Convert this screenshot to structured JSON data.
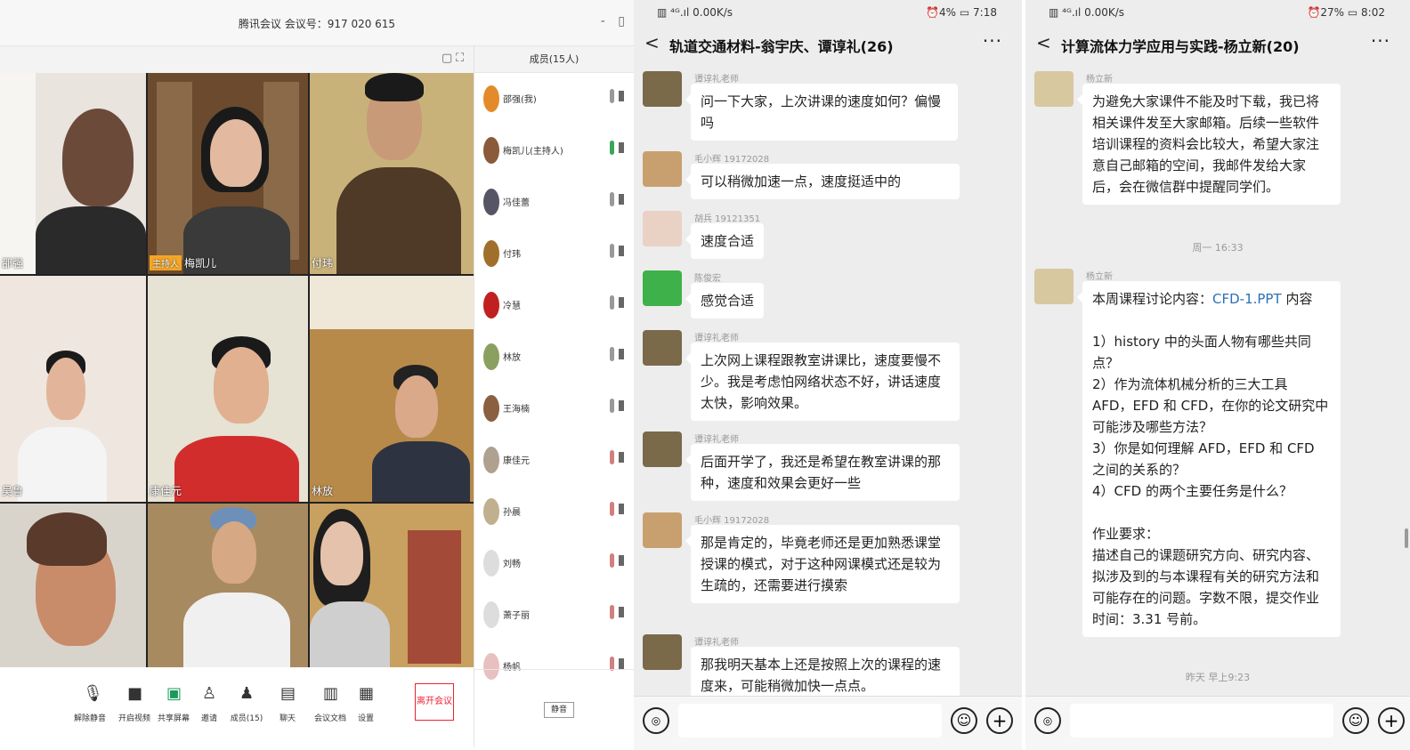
{
  "meeting": {
    "title": "腾讯会议 会议号：917 020 615",
    "window_controls": [
      "-",
      "▯"
    ],
    "members_header": "成员(15人)",
    "tiles": [
      {
        "name": "邵强",
        "host": ""
      },
      {
        "name": "梅凯儿",
        "host": "主持人"
      },
      {
        "name": "付玮",
        "host": ""
      },
      {
        "name": "吴鲁",
        "host": ""
      },
      {
        "name": "康佳元",
        "host": ""
      },
      {
        "name": "林放",
        "host": ""
      },
      {
        "name": "",
        "host": ""
      },
      {
        "name": "",
        "host": ""
      },
      {
        "name": "",
        "host": ""
      }
    ],
    "members": [
      {
        "name": "邵强(我)"
      },
      {
        "name": "梅凯儿(主持人)"
      },
      {
        "name": "冯佳蕾"
      },
      {
        "name": "付玮"
      },
      {
        "name": "冷慧"
      },
      {
        "name": "林放"
      },
      {
        "name": "王海楠"
      },
      {
        "name": "康佳元"
      },
      {
        "name": "孙晨"
      },
      {
        "name": "刘畅"
      },
      {
        "name": "萧子丽"
      },
      {
        "name": "杨帆"
      }
    ],
    "members_footer_button": "静音",
    "toolbar": [
      {
        "label": "解除静音",
        "icon": "mic-icon",
        "glyph": "🎤"
      },
      {
        "label": "开启视频",
        "icon": "camera-icon",
        "glyph": "■"
      },
      {
        "label": "共享屏幕",
        "icon": "share-screen-icon",
        "glyph": "▣"
      },
      {
        "label": "邀请",
        "icon": "invite-icon",
        "glyph": "♙"
      },
      {
        "label": "成员(15)",
        "icon": "members-icon",
        "glyph": "♟"
      },
      {
        "label": "聊天",
        "icon": "chat-icon",
        "glyph": "▤"
      },
      {
        "label": "会议文档",
        "icon": "document-icon",
        "glyph": "▥"
      },
      {
        "label": "设置",
        "icon": "settings-icon",
        "glyph": "▦"
      }
    ],
    "end_button": "离开会议"
  },
  "chat1": {
    "status_left": "▥ ⁴ᴳ.ıl 0.00K/s",
    "status_right": "⏰4% ▭ 7:18",
    "title": "轨道交通材料-翁宇庆、谭谆礼(26)",
    "more": "···",
    "back": "<",
    "messages": [
      {
        "sender": "谭谆礼老师",
        "text": "问一下大家，上次讲课的速度如何？偏慢吗"
      },
      {
        "sender": "毛小辉 19172028",
        "text": "可以稍微加速一点，速度挺适中的"
      },
      {
        "sender": "胡兵 19121351",
        "text": "速度合适"
      },
      {
        "sender": "陈俊宏",
        "text": "感觉合适"
      },
      {
        "sender": "谭谆礼老师",
        "text": "上次网上课程跟教室讲课比，速度要慢不少。我是考虑怕网络状态不好，讲话速度太快，影响效果。"
      },
      {
        "sender": "谭谆礼老师",
        "text": "后面开学了，我还是希望在教室讲课的那种，速度和效果会更好一些"
      },
      {
        "sender": "毛小辉 19172028",
        "text": "那是肯定的，毕竟老师还是更加熟悉课堂授课的模式，对于这种网课模式还是较为生疏的，还需要进行摸索"
      },
      {
        "sender": "谭谆礼老师",
        "text": "那我明天基本上还是按照上次的课程的速度来，可能稍微加快一点点。"
      }
    ],
    "voice": "◎",
    "emoji": "☺",
    "plus": "+"
  },
  "chat2": {
    "status_left": "▥ ⁴ᴳ.ıl 0.00K/s",
    "status_right": "⏰27% ▭ 8:02",
    "title": "计算流体力学应用与实践-杨立新(20)",
    "more": "···",
    "back": "<",
    "msg1_sender": "杨立新",
    "msg1_text": "为避免大家课件不能及时下载，我已将相关课件发至大家邮箱。后续一些软件培训课程的资料会比较大，希望大家注意自己邮箱的空间，我邮件发给大家后，会在微信群中提醒同学们。",
    "time1": "周一 16:33",
    "msg2_sender": "杨立新",
    "msg2_intro": "本周课程讨论内容：",
    "msg2_link": "CFD-1.PPT",
    "msg2_intro_tail": "内容",
    "msg2_q1": "1）history 中的头面人物有哪些共同点？",
    "msg2_q2": "2）作为流体机械分析的三大工具 AFD，EFD 和 CFD，在你的论文研究中可能涉及哪些方法？",
    "msg2_q3": "3）你是如何理解 AFD，EFD 和 CFD 之间的关系的？",
    "msg2_q4": "4）CFD 的两个主要任务是什么？",
    "msg2_hw_title": "作业要求：",
    "msg2_hw": "描述自己的课题研究方向、研究内容、拟涉及到的与本课程有关的研究方法和可能存在的问题。字数不限，提交作业时间：3.31 号前。",
    "time2": "昨天 早上9:23",
    "voice": "◎",
    "emoji": "☺",
    "plus": "+"
  },
  "colors": {
    "host_badge": "#f5a623",
    "end_red": "#e23030",
    "link_blue": "#2d6fb5",
    "chat_bg": "#ededed"
  }
}
